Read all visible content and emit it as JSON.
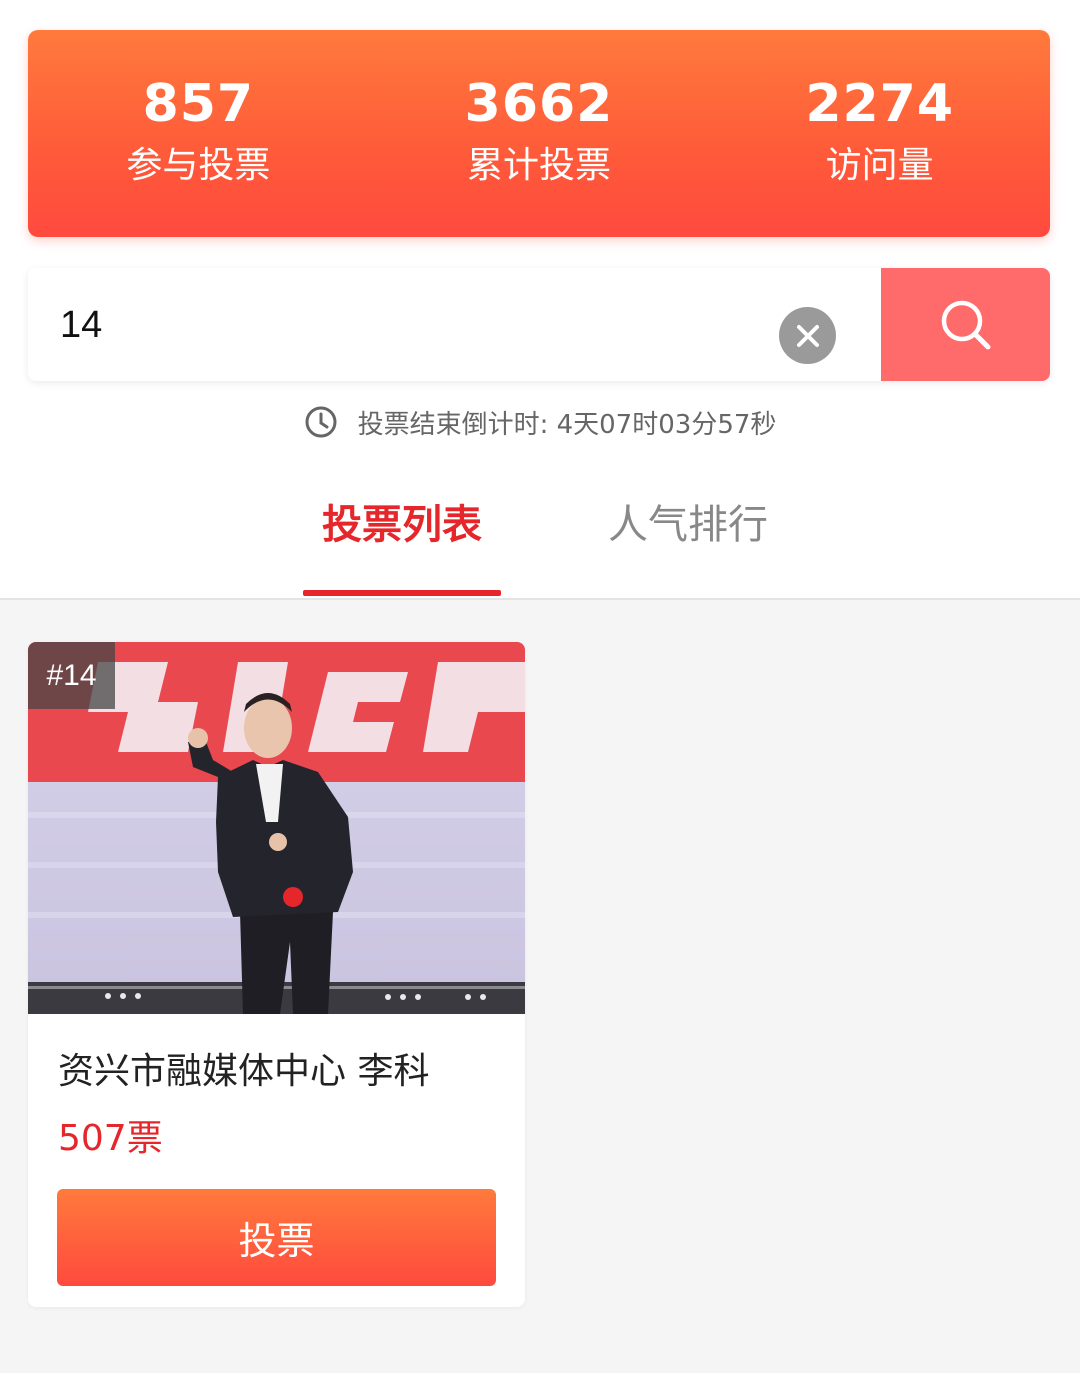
{
  "stats": [
    {
      "value": "857",
      "label": "参与投票"
    },
    {
      "value": "3662",
      "label": "累计投票"
    },
    {
      "value": "2274",
      "label": "访问量"
    }
  ],
  "search": {
    "value": "14",
    "clear_icon": "close-icon",
    "search_icon": "search-icon"
  },
  "countdown": {
    "text": "投票结束倒计时: 4天07时03分57秒",
    "icon": "clock-icon"
  },
  "tabs": [
    {
      "label": "投票列表",
      "active": true
    },
    {
      "label": "人气排行",
      "active": false
    }
  ],
  "colors": {
    "accent": "#e5262b",
    "gradient_top": "#ff7a3c",
    "gradient_bottom": "#ff4a3e",
    "search_button": "#ff6b6b"
  },
  "candidates": [
    {
      "badge": "#14",
      "name": "资兴市融媒体中心 李科",
      "votes": "507票",
      "vote_button_label": "投票"
    }
  ]
}
